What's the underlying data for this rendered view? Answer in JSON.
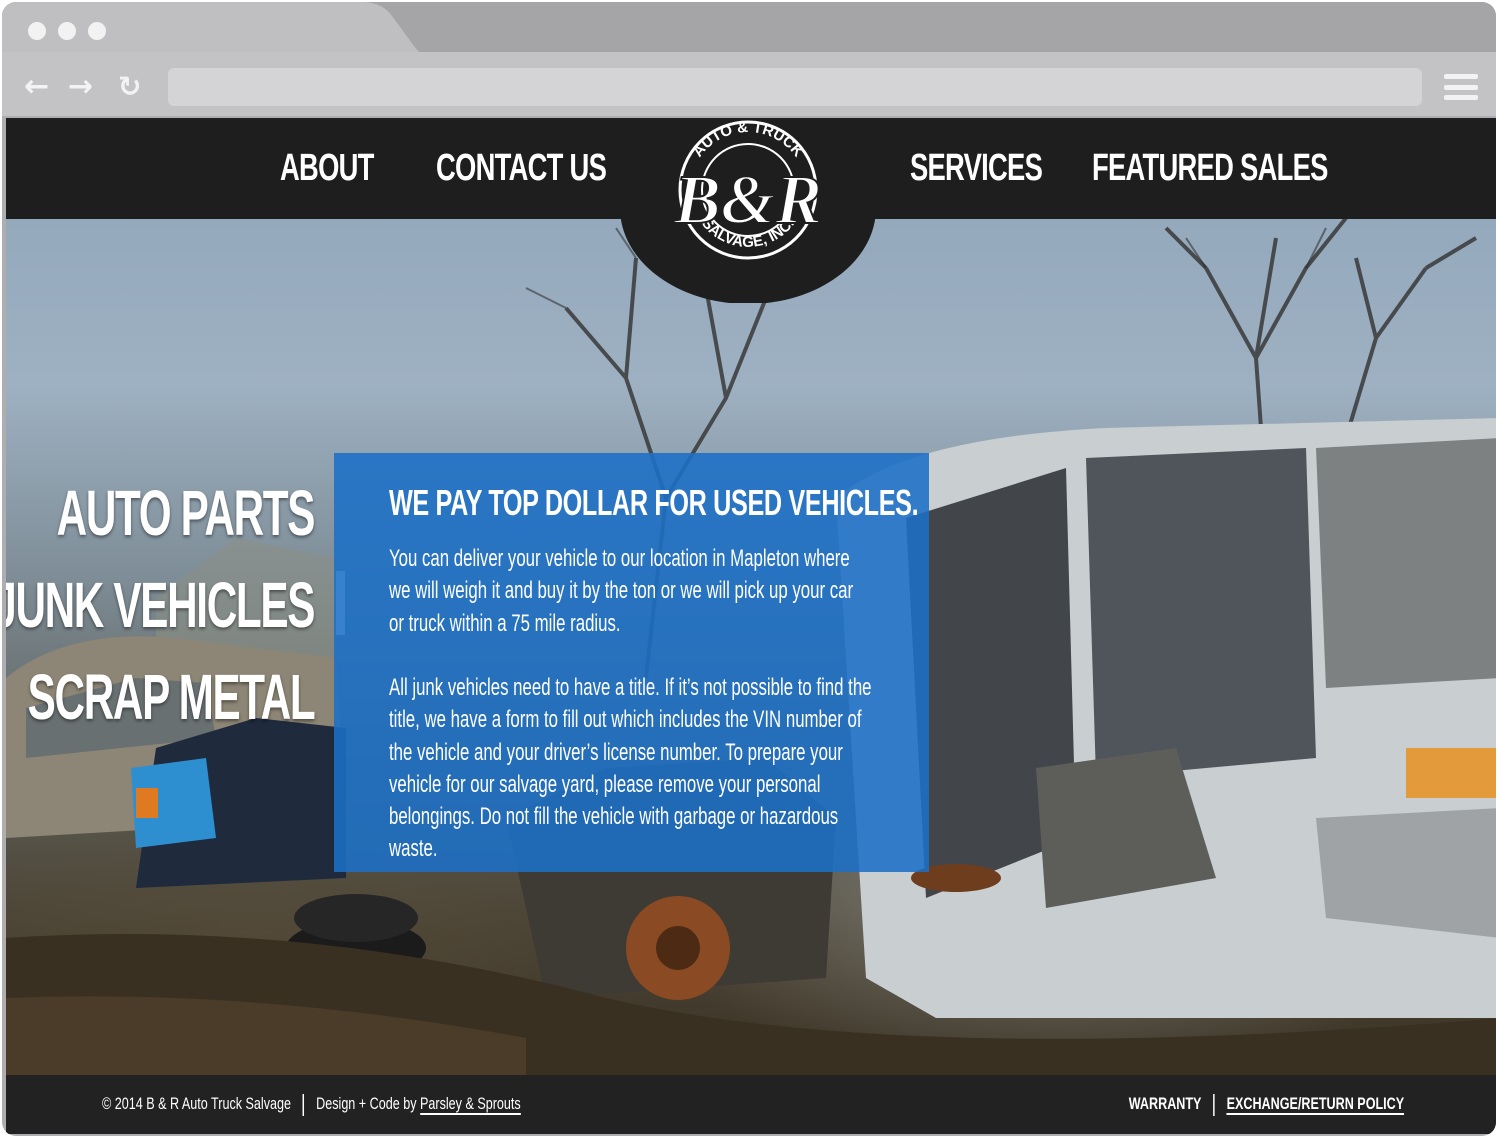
{
  "nav": {
    "links_left": [
      "ABOUT",
      "CONTACT US"
    ],
    "links_right": [
      "SERVICES",
      "FEATURED SALES"
    ]
  },
  "logo": {
    "monogram": "B&R",
    "top_arc": "AUTO & TRUCK",
    "bottom_arc": "SALVAGE, INC."
  },
  "services": {
    "items": [
      "AUTO PARTS",
      "JUNK VEHICLES",
      "SCRAP METAL"
    ],
    "active_index": 1
  },
  "panel": {
    "title": "WE PAY TOP DOLLAR FOR USED VEHICLES.",
    "paragraph1": "You can deliver your vehicle to our location in Mapleton where we will weigh it and buy it by the ton or we will pick up your car or truck within a 75 mile radius.",
    "paragraph2": "All junk vehicles need to have a title. If it’s not possible to find the title, we have a form to fill out which includes the VIN number of the vehicle and your driver’s license number. To prepare your vehicle for our salvage yard, please remove your personal belongings. Do not fill the vehicle with garbage or hazardous waste."
  },
  "footer": {
    "copyright": "© 2014 B & R Auto Truck Salvage",
    "credit_prefix": "Design + Code by",
    "credit_link": "Parsley & Sprouts",
    "links": [
      "WARRANTY",
      "EXCHANGE/RETURN POLICY"
    ]
  },
  "browser": {
    "icons": [
      "back-arrow-icon",
      "forward-arrow-icon",
      "reload-icon",
      "hamburger-menu-icon"
    ]
  },
  "colors": {
    "nav_bg": "#1e1e1e",
    "panel_blue": "#1c70c6",
    "chrome_gray": "#aeaeb1"
  }
}
